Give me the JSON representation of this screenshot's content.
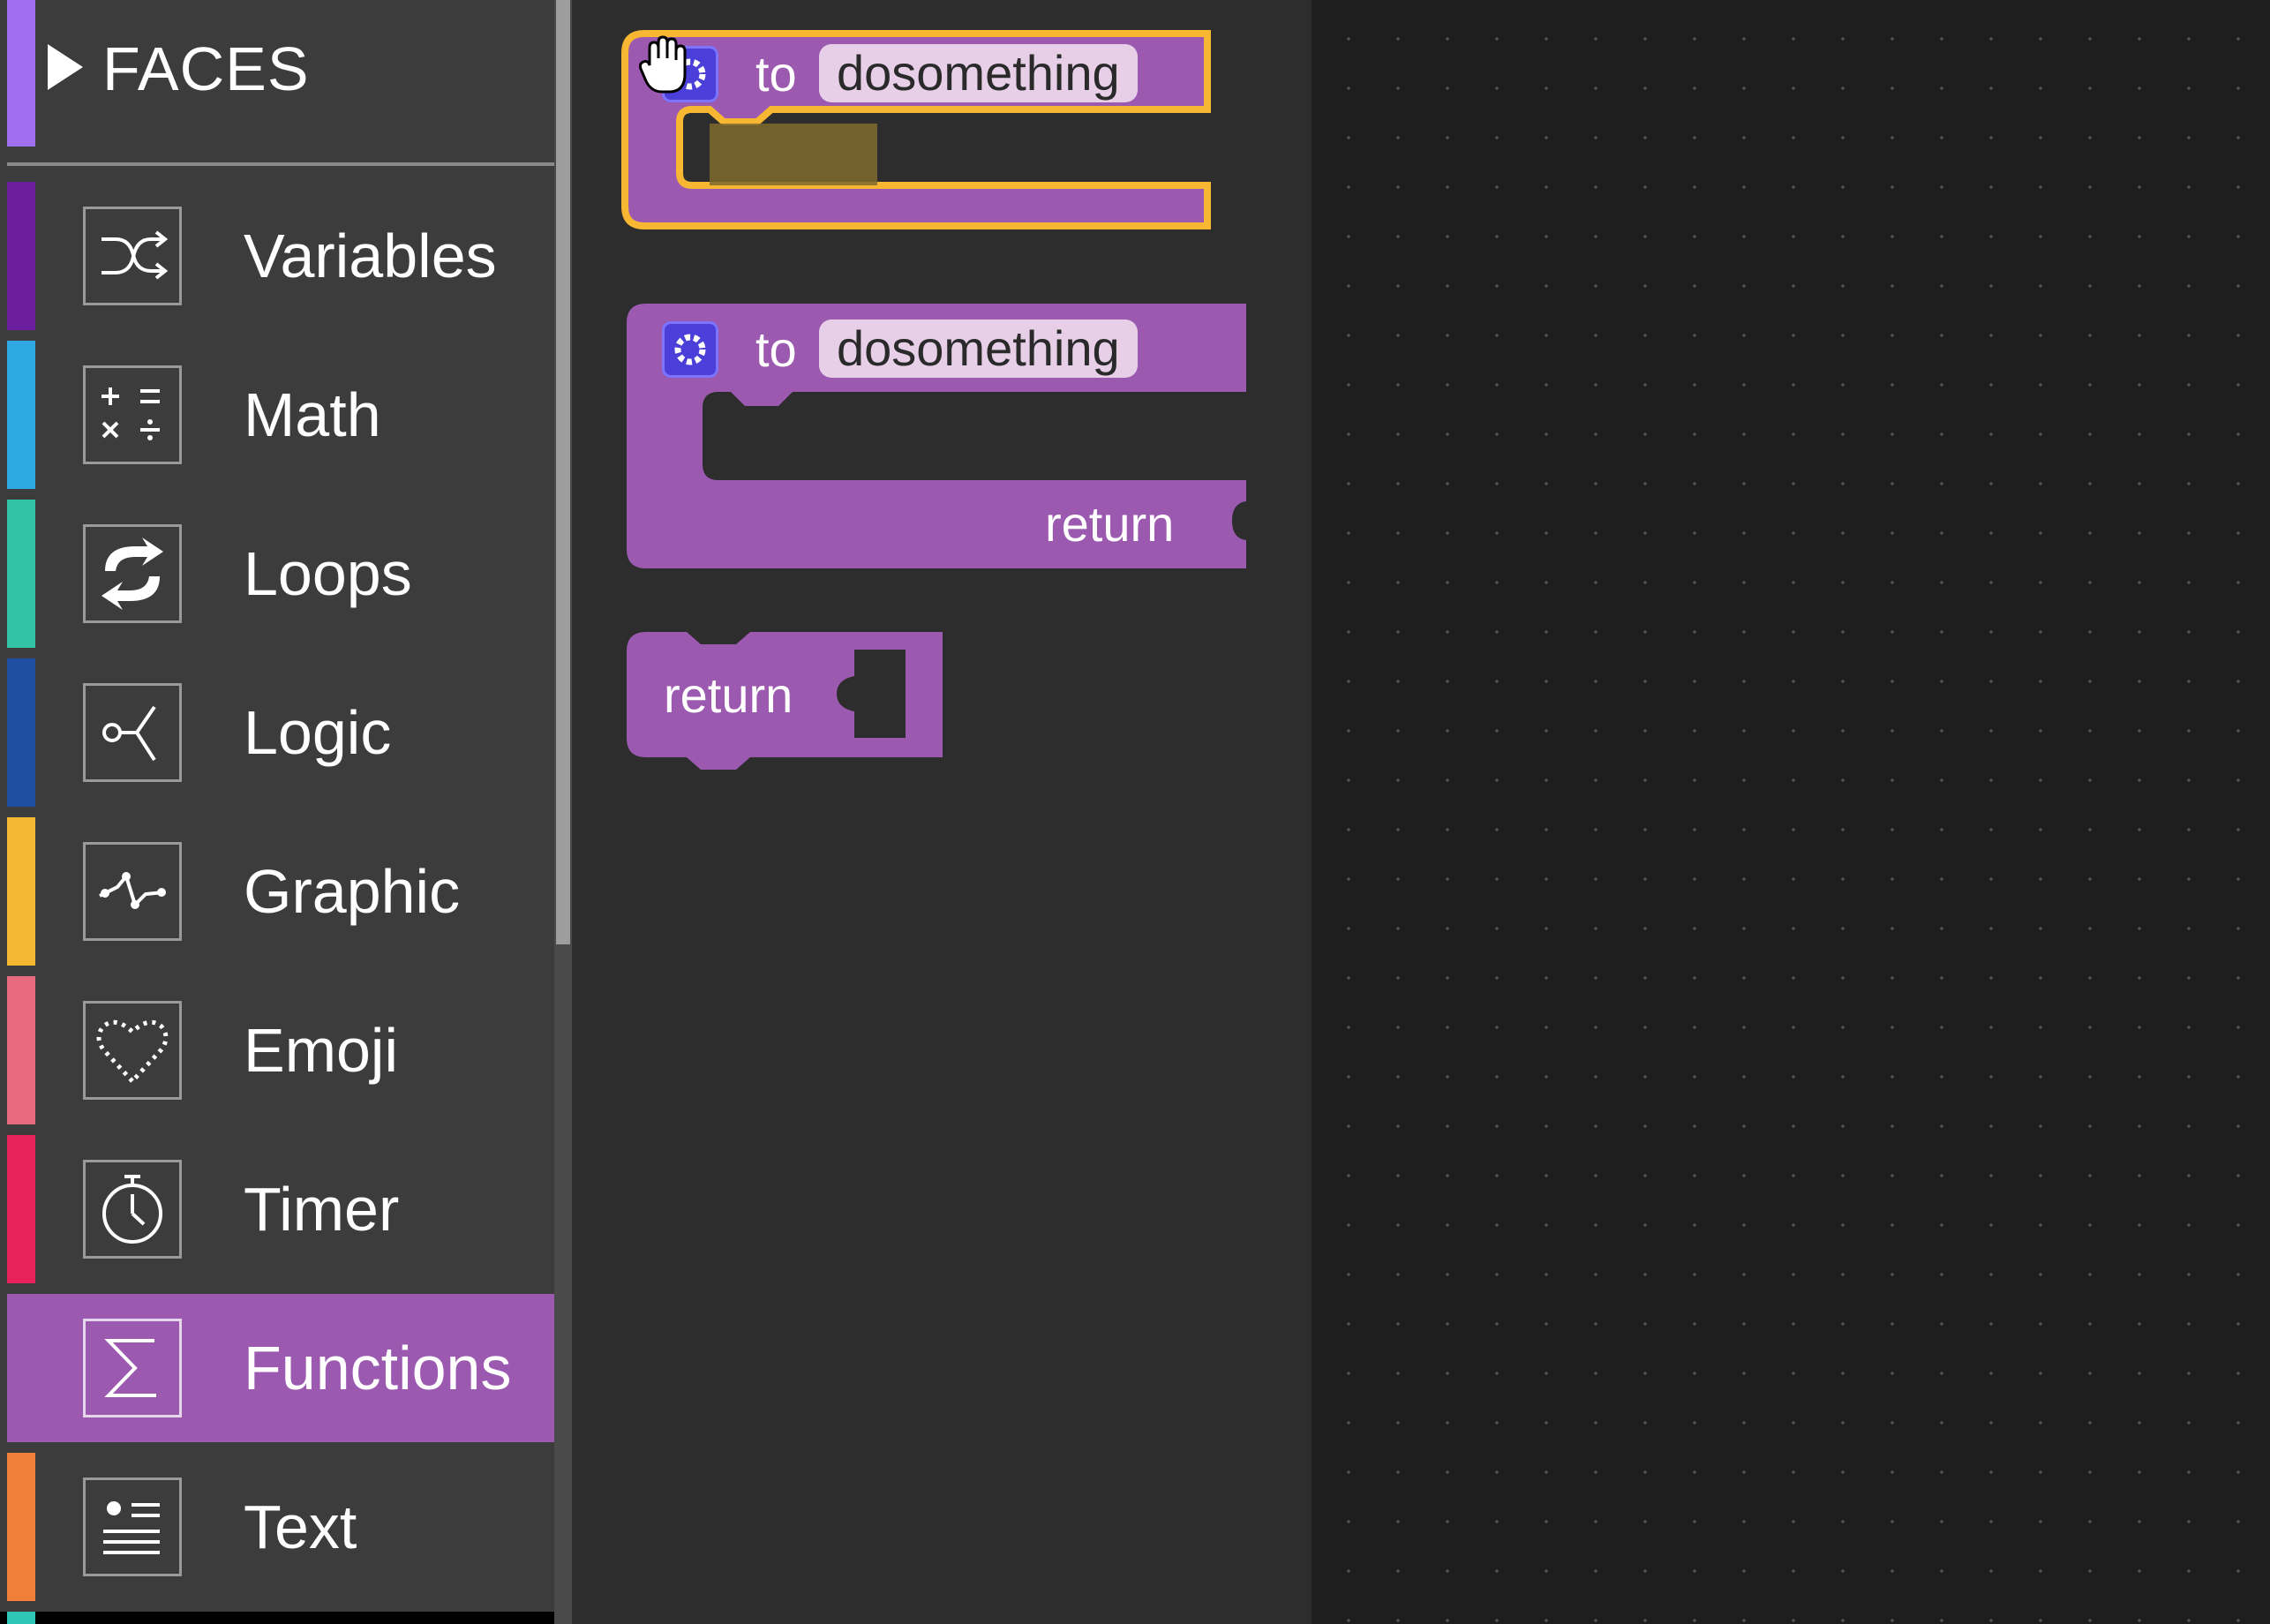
{
  "sidebar": {
    "header": {
      "label": "FACES",
      "color": "#a06ef0"
    },
    "categories": [
      {
        "label": "Variables",
        "icon": "shuffle-icon",
        "color": "#6c1e9e"
      },
      {
        "label": "Math",
        "icon": "math-operators-icon",
        "color": "#2ea8e0"
      },
      {
        "label": "Loops",
        "icon": "loop-arrows-icon",
        "color": "#32c3a4"
      },
      {
        "label": "Logic",
        "icon": "branch-icon",
        "color": "#1f4fa0"
      },
      {
        "label": "Graphic",
        "icon": "path-nodes-icon",
        "color": "#f4b731"
      },
      {
        "label": "Emoji",
        "icon": "heart-dotted-icon",
        "color": "#e86a7e"
      },
      {
        "label": "Timer",
        "icon": "stopwatch-icon",
        "color": "#e8215a"
      },
      {
        "label": "Functions",
        "icon": "sigma-icon",
        "color": "#9b59b0",
        "selected": true
      },
      {
        "label": "Text",
        "icon": "text-card-icon",
        "color": "#f07f3a"
      }
    ]
  },
  "flyout": {
    "block_color": "#9b59b0",
    "highlight_color": "#f7b733",
    "blocks": [
      {
        "keyword": "to",
        "name": "dosomething",
        "gear_icon": "gear-icon",
        "highlighted": true
      },
      {
        "keyword": "to",
        "name": "dosomething",
        "gear_icon": "gear-icon",
        "return_label": "return"
      },
      {
        "label": "return"
      }
    ]
  },
  "cursor": {
    "icon": "grab-hand-cursor-icon"
  }
}
